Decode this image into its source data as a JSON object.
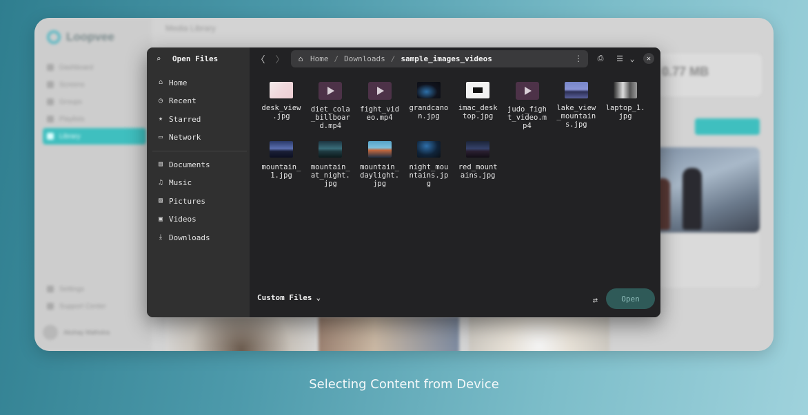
{
  "background_app": {
    "logo": "Loopvee",
    "top_title": "Media Library",
    "nav": [
      "Dashboard",
      "Screens",
      "Groups",
      "Playlists",
      "Library"
    ],
    "bottom_nav": [
      "Settings",
      "Support Center"
    ],
    "stat_value": "0.77 MB",
    "user_name": "Akshay Malhotra"
  },
  "dialog": {
    "title": "Open Files",
    "sidebar_places": [
      {
        "label": "Home",
        "icon": "home-icon",
        "glyph": "⌂"
      },
      {
        "label": "Recent",
        "icon": "clock-icon",
        "glyph": "◷"
      },
      {
        "label": "Starred",
        "icon": "star-icon",
        "glyph": "★"
      },
      {
        "label": "Network",
        "icon": "network-icon",
        "glyph": "▭"
      }
    ],
    "sidebar_folders": [
      {
        "label": "Documents",
        "icon": "document-icon",
        "glyph": "▤"
      },
      {
        "label": "Music",
        "icon": "music-icon",
        "glyph": "♫"
      },
      {
        "label": "Pictures",
        "icon": "picture-icon",
        "glyph": "▨"
      },
      {
        "label": "Videos",
        "icon": "video-icon",
        "glyph": "▣"
      },
      {
        "label": "Downloads",
        "icon": "download-icon",
        "glyph": "⤓"
      }
    ],
    "path": {
      "home": "Home",
      "sep1": "/",
      "downloads": "Downloads",
      "sep2": "/",
      "current": "sample_images_videos"
    },
    "files": [
      {
        "name": "desk_view\n.jpg",
        "kind": "th-desk"
      },
      {
        "name": "diet_cola\n_billboar\nd.mp4",
        "kind": "video"
      },
      {
        "name": "fight_vid\neo.mp4",
        "kind": "video"
      },
      {
        "name": "grandcano\nn.jpg",
        "kind": "th-grand"
      },
      {
        "name": "imac_desk\ntop.jpg",
        "kind": "th-imac"
      },
      {
        "name": "judo_figh\nt_video.m\np4",
        "kind": "video"
      },
      {
        "name": "lake_view\n_mountain\ns.jpg",
        "kind": "th-lake"
      },
      {
        "name": "laptop_1.\njpg",
        "kind": "th-laptop"
      },
      {
        "name": "mountain_\n1.jpg",
        "kind": "th-mtn1"
      },
      {
        "name": "mountain_\nat_night.\njpg",
        "kind": "th-mtn-night"
      },
      {
        "name": "mountain_\ndaylight.\njpg",
        "kind": "th-mtn-day"
      },
      {
        "name": "night_mou\nntains.jp\ng",
        "kind": "th-night"
      },
      {
        "name": "red_mount\nains.jpg",
        "kind": "th-red"
      }
    ],
    "filter_label": "Custom Files",
    "open_label": "Open"
  },
  "caption": "Selecting Content from Device",
  "colors": {
    "accent": "#3fbfbf",
    "dialog_bg": "#222224",
    "sidebar_bg": "#303030",
    "open_button": "#2f5a58"
  }
}
